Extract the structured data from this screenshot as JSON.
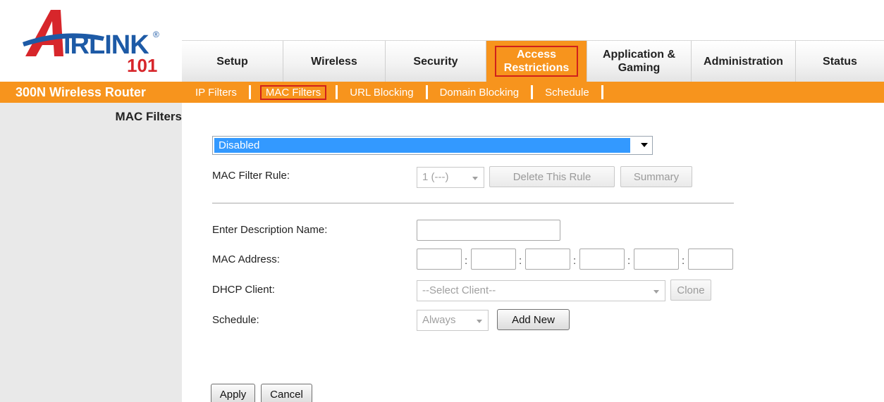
{
  "logo": {
    "text": "AIRLINK",
    "number": "101",
    "registered": "®"
  },
  "nav": {
    "tabs": [
      {
        "label": "Setup"
      },
      {
        "label": "Wireless"
      },
      {
        "label": "Security"
      },
      {
        "label": "Access Restrictions",
        "active": true
      },
      {
        "label": "Application & Gaming"
      },
      {
        "label": "Administration"
      },
      {
        "label": "Status"
      }
    ]
  },
  "subnav": {
    "model": "300N Wireless Router",
    "links": [
      {
        "label": "IP Filters"
      },
      {
        "label": "MAC Filters",
        "active": true
      },
      {
        "label": "URL Blocking"
      },
      {
        "label": "Domain Blocking"
      },
      {
        "label": "Schedule"
      }
    ]
  },
  "sidebar": {
    "title": "MAC Filters"
  },
  "form": {
    "mode_value": "Disabled",
    "rule_label": "MAC Filter Rule:",
    "rule_value": "1 (---)",
    "delete_rule_label": "Delete This Rule",
    "summary_label": "Summary",
    "description_label": "Enter Description Name:",
    "description_value": "",
    "mac_label": "MAC Address:",
    "mac_separator": ":",
    "dhcp_label": "DHCP Client:",
    "dhcp_value": "--Select Client--",
    "clone_label": "Clone",
    "schedule_label": "Schedule:",
    "schedule_value": "Always",
    "add_new_label": "Add New",
    "apply_label": "Apply",
    "cancel_label": "Cancel"
  },
  "colors": {
    "accent": "#f7941d",
    "highlight": "#d0201c",
    "selection": "#3399ff",
    "logo_blue": "#1d5aa6",
    "logo_red": "#d7262b"
  }
}
